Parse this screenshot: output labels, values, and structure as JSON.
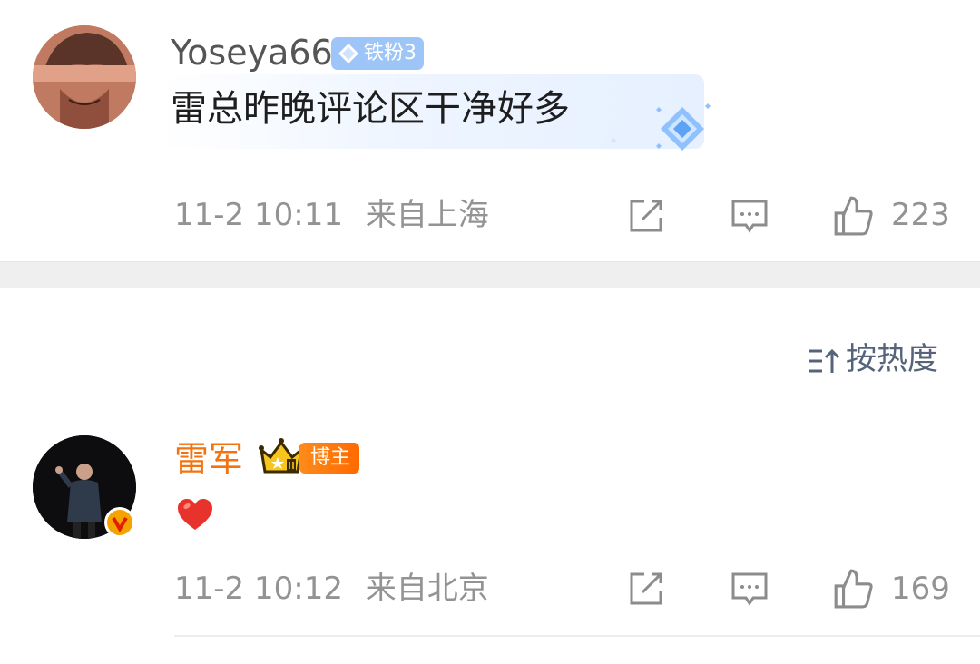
{
  "posts": [
    {
      "username": "Yoseya66",
      "fan_badge": "铁粉3",
      "content": "雷总昨晚评论区干净好多",
      "timestamp": "11-2 10:11",
      "location": "来自上海",
      "likes": "223",
      "username_color": "#555555"
    },
    {
      "username": "雷军",
      "role_badge": "博主",
      "content_icon": "red-heart-icon",
      "timestamp": "11-2 10:12",
      "location": "来自北京",
      "likes": "169",
      "username_color": "#f2730f"
    }
  ],
  "sort": {
    "label": "按热度",
    "icon": "sort-icon"
  },
  "colors": {
    "accent_orange": "#ff6a00",
    "fan_blue": "#9ec5f7",
    "meta_gray": "#939393",
    "sort_blue": "#55647a"
  }
}
